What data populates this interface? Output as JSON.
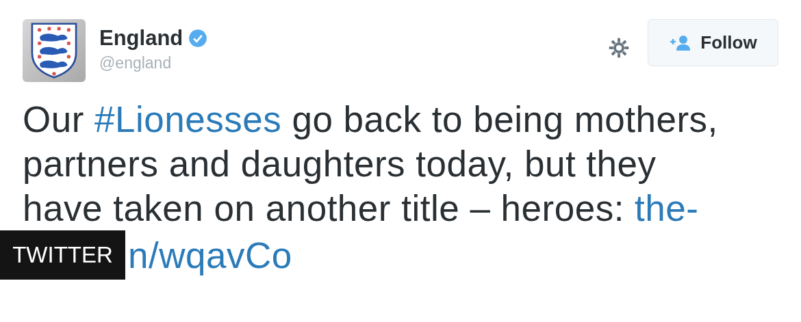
{
  "tweet": {
    "name": "England",
    "verified": true,
    "handle": "@england",
    "follow_button": "Follow",
    "text_lines": [
      [
        {
          "kind": "text",
          "text": "Our "
        },
        {
          "kind": "link",
          "text": "#Lionesses"
        },
        {
          "kind": "text",
          "text": " go back to being mothers,"
        }
      ],
      [
        {
          "kind": "text",
          "text": "partners and daughters today, but they"
        }
      ],
      [
        {
          "kind": "text",
          "text": "have taken on another title – heroes: "
        },
        {
          "kind": "link",
          "text": "the-"
        }
      ],
      [
        {
          "kind": "link",
          "text": "n/wqavCo"
        }
      ]
    ]
  },
  "caption": {
    "source": "TWITTER"
  }
}
